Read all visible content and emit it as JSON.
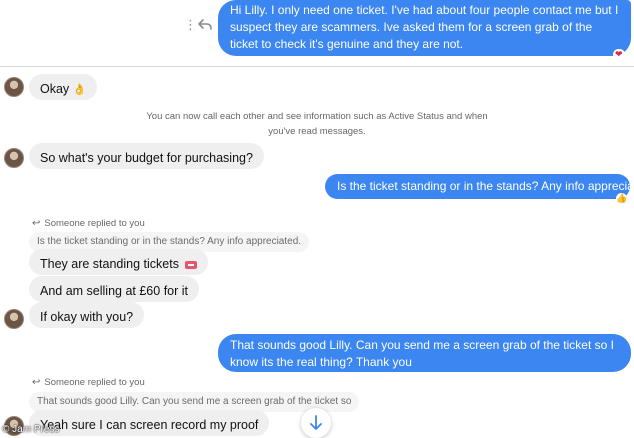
{
  "messages": {
    "m1": "Hi Lilly. I only need one ticket. I've had about four people contact me but I suspect they are scammers. Ive asked them for a screen grab of the ticket to check it's genuine and they are not.",
    "m2": "Okay",
    "m3": "So what's your budget for purchasing?",
    "m4": "Is the ticket standing or in the stands? Any info appreciated.",
    "m5": "They are standing tickets",
    "m6": "And am selling at £60 for it",
    "m7": "If okay with you?",
    "m8": "That sounds good Lilly. Can you send me a screen grab of the ticket so I know its the real thing? Thank you",
    "m9": "Yeah sure I can screen record my proof"
  },
  "reactions": {
    "m1_reaction": "❤",
    "m2_emoji": "👌",
    "m4_reaction": "👍"
  },
  "system_notice": {
    "line1": "You can now call each other and see information such as Active Status and when",
    "line2": "you've read messages."
  },
  "replies": {
    "r1_label": "Someone replied to you",
    "r1_quote": "Is the ticket standing or in the stands? Any info appreciated.",
    "r2_label": "Someone replied to you",
    "r2_quote": "That sounds good Lilly. Can you send me a screen grab of the ticket so"
  },
  "watermark": "Jam Press",
  "colors": {
    "outgoing": "#3b86f0",
    "incoming": "#efefef",
    "muted_text": "#65676b"
  },
  "icons": {
    "more": "more-vertical-icon",
    "reply": "reply-icon",
    "scroll_down": "arrow-down-icon",
    "copyright": "copyright-icon"
  }
}
